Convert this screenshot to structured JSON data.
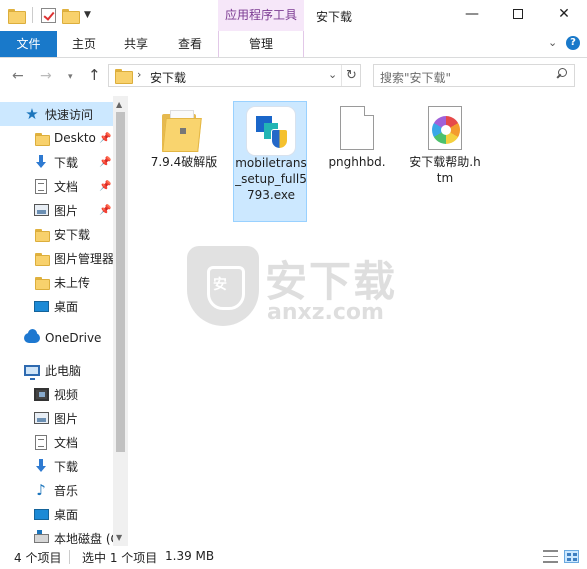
{
  "window": {
    "title": "安下载",
    "context_tab_group": "应用程序工具",
    "controls": {
      "minimize": "—",
      "close": "✕"
    }
  },
  "ribbon": {
    "tabs": [
      {
        "label": "文件",
        "active": true
      },
      {
        "label": "主页"
      },
      {
        "label": "共享"
      },
      {
        "label": "查看"
      },
      {
        "label": "管理"
      }
    ],
    "collapse_glyph": "⌄",
    "help_glyph": "?"
  },
  "address": {
    "back_glyph": "←",
    "forward_glyph": "→",
    "recent_glyph": "▾",
    "up_glyph": "↑",
    "crumb": "安下载",
    "refresh_glyph": "↻",
    "search_placeholder": "搜索\"安下载\""
  },
  "nav": {
    "items": [
      {
        "label": "快速访问",
        "icon": "star-icon",
        "selected": true
      },
      {
        "label": "Deskto",
        "icon": "folder-icon",
        "pinned": true
      },
      {
        "label": "下载",
        "icon": "download-icon",
        "pinned": true
      },
      {
        "label": "文档",
        "icon": "document-icon",
        "pinned": true
      },
      {
        "label": "图片",
        "icon": "picture-icon",
        "pinned": true
      },
      {
        "label": "安下载",
        "icon": "folder-icon"
      },
      {
        "label": "图片管理器",
        "icon": "folder-icon"
      },
      {
        "label": "未上传",
        "icon": "folder-icon"
      },
      {
        "label": "桌面",
        "icon": "desktop-icon"
      },
      {
        "label": "OneDrive",
        "icon": "onedrive-icon"
      },
      {
        "label": "此电脑",
        "icon": "computer-icon"
      },
      {
        "label": "视频",
        "icon": "video-icon"
      },
      {
        "label": "图片",
        "icon": "picture-icon"
      },
      {
        "label": "文档",
        "icon": "document-icon"
      },
      {
        "label": "下载",
        "icon": "download-icon"
      },
      {
        "label": "音乐",
        "icon": "music-icon"
      },
      {
        "label": "桌面",
        "icon": "desktop-icon"
      },
      {
        "label": "本地磁盘 (C",
        "icon": "drive-icon"
      }
    ],
    "pin_glyph": "📌"
  },
  "files": [
    {
      "name": "7.9.4破解版",
      "type": "folder",
      "icon": "folder-icon"
    },
    {
      "name": "mobiletrans_setup_full5793.exe",
      "type": "exe",
      "icon": "mobiletrans-app-icon",
      "selected": true
    },
    {
      "name": "pnghhbd.",
      "type": "blank",
      "icon": "blank-file-icon"
    },
    {
      "name": "安下载帮助.htm",
      "type": "htm",
      "icon": "htm-file-icon"
    }
  ],
  "watermark": {
    "badge": "安",
    "brand_cn": "安下载",
    "brand_en": "anxz.com"
  },
  "status": {
    "item_count": "4 个项目",
    "selection": "选中 1 个项目",
    "size": "1.39 MB"
  }
}
